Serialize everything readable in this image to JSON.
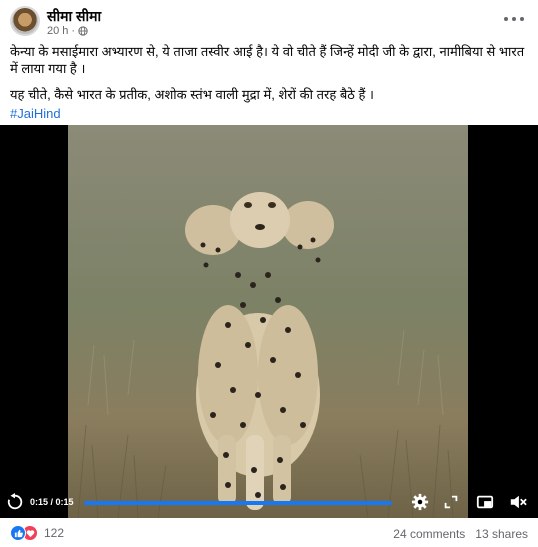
{
  "post": {
    "author": "सीमा सीमा",
    "time": "20 h",
    "privacy_icon": "globe-icon",
    "more_icon": "more-options-icon",
    "text_line1": "केन्या के मसाईमारा  अभ्यारण से, ये ताजा तस्वीर आई है। ये वो चीते हैं जिन्हें मोदी जी के द्वारा, नामीबिया से भारत में लाया गया है ।",
    "text_line2": " यह चीते,  कैसे भारत के प्रतीक, अशोक स्तंभ वाली मुद्रा में, शेरों की तरह बैठे हैं ।",
    "hashtag": "#JaiHind"
  },
  "video": {
    "time_display": "0:15 / 0:15",
    "progress": 1.0,
    "icons": [
      "replay-icon",
      "settings-icon",
      "fullscreen-icon",
      "miniplayer-icon",
      "volume-muted-icon"
    ]
  },
  "footer": {
    "reaction_count": "122",
    "comments": "24 comments",
    "shares": "13 shares"
  },
  "colors": {
    "accent": "#1877f2",
    "love": "#f33e58",
    "link": "#216fdb",
    "muted": "#65676b"
  }
}
